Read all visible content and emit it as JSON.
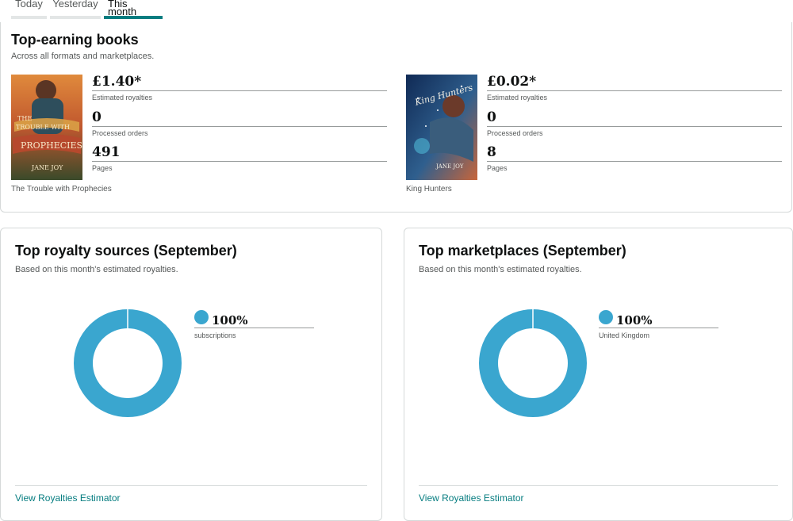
{
  "tabs": [
    {
      "label": "Today",
      "selected": false
    },
    {
      "label": "Yesterday",
      "selected": false
    },
    {
      "label": "This month",
      "selected": true
    }
  ],
  "top_earning": {
    "title": "Top-earning books",
    "subtitle": "Across all formats and marketplaces.",
    "books": [
      {
        "name": "The Trouble with Prophecies",
        "cover_lines": [
          "THE",
          "TROUBLE WITH",
          "PROPHECIES",
          "JANE JOY"
        ],
        "stats": [
          {
            "value": "£1.40*",
            "label": "Estimated royalties"
          },
          {
            "value": "0",
            "label": "Processed orders"
          },
          {
            "value": "491",
            "label": "Pages"
          }
        ]
      },
      {
        "name": "King Hunters",
        "cover_lines": [
          "King Hunters",
          "JANE JOY"
        ],
        "stats": [
          {
            "value": "£0.02*",
            "label": "Estimated royalties"
          },
          {
            "value": "0",
            "label": "Processed orders"
          },
          {
            "value": "8",
            "label": "Pages"
          }
        ]
      }
    ]
  },
  "cards": [
    {
      "title": "Top royalty sources (September)",
      "subtitle": "Based on this month's estimated royalties.",
      "legend": {
        "value": "100%",
        "label": "subscriptions"
      },
      "link": "View Royalties Estimator"
    },
    {
      "title": "Top marketplaces (September)",
      "subtitle": "Based on this month's estimated royalties.",
      "legend": {
        "value": "100%",
        "label": "United Kingdom"
      },
      "link": "View Royalties Estimator"
    }
  ],
  "chart_data": [
    {
      "type": "pie",
      "categories": [
        "subscriptions"
      ],
      "values": [
        100
      ]
    },
    {
      "type": "pie",
      "categories": [
        "United Kingdom"
      ],
      "values": [
        100
      ]
    }
  ],
  "colors": {
    "accent": "#067d80",
    "donut": "#3aa6cf",
    "tab_inactive": "#e3e6e6"
  }
}
